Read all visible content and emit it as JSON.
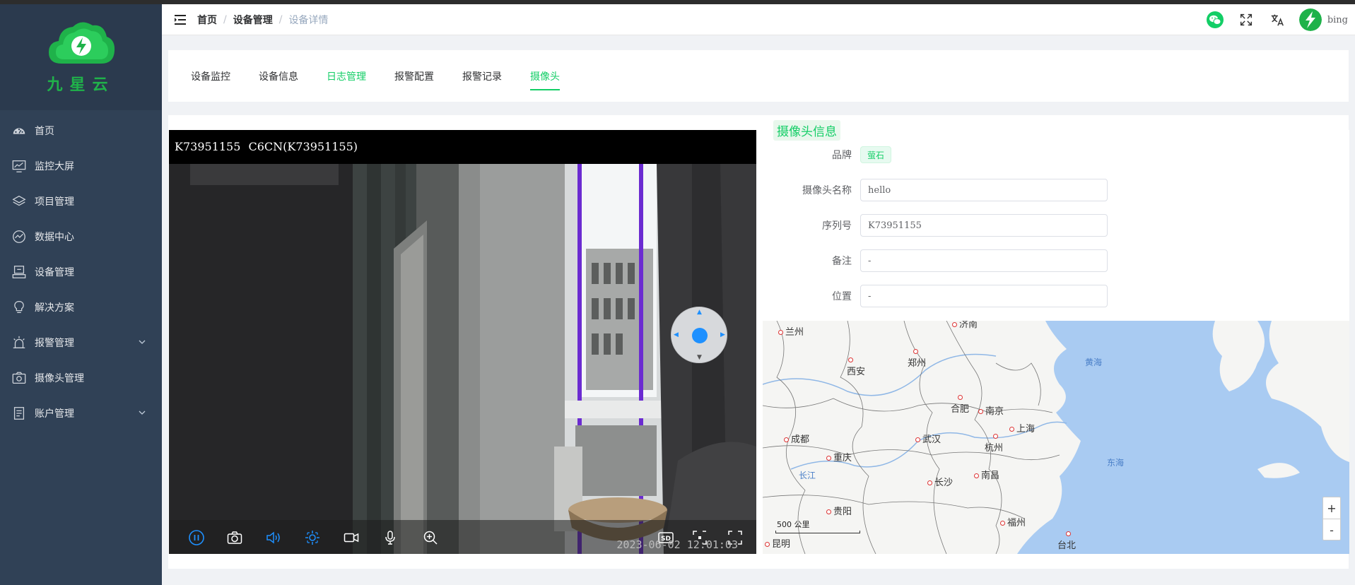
{
  "sidebar": {
    "logo_text": "九星云",
    "items": [
      {
        "label": "首页",
        "icon": "dashboard-icon"
      },
      {
        "label": "监控大屏",
        "icon": "monitor-icon"
      },
      {
        "label": "项目管理",
        "icon": "layers-icon"
      },
      {
        "label": "数据中心",
        "icon": "chart-icon"
      },
      {
        "label": "设备管理",
        "icon": "device-icon"
      },
      {
        "label": "解决方案",
        "icon": "bulb-icon"
      },
      {
        "label": "报警管理",
        "icon": "alarm-icon"
      },
      {
        "label": "摄像头管理",
        "icon": "camera-icon"
      },
      {
        "label": "账户管理",
        "icon": "account-icon"
      }
    ]
  },
  "header": {
    "breadcrumb": [
      "首页",
      "设备管理",
      "设备详情"
    ],
    "username": "bing"
  },
  "tabs": [
    {
      "label": "设备监控"
    },
    {
      "label": "设备信息"
    },
    {
      "label": "日志管理"
    },
    {
      "label": "报警配置"
    },
    {
      "label": "报警记录"
    },
    {
      "label": "摄像头"
    }
  ],
  "video": {
    "title": "K73951155   C6CN(K73951155)",
    "timestamp": "2023-06-02 12:01:03",
    "quality": "SD"
  },
  "info": {
    "title": "摄像头信息",
    "brand_label": "品牌",
    "brand_value": "萤石",
    "name_label": "摄像头名称",
    "name_value": "hello",
    "serial_label": "序列号",
    "serial_value": "K73951155",
    "remark_label": "备注",
    "remark_value": "-",
    "location_label": "位置",
    "location_value": "-"
  },
  "map": {
    "cities": [
      "兰州",
      "济南",
      "西安",
      "郑州",
      "南京",
      "合肥",
      "上海",
      "成都",
      "武汉",
      "重庆",
      "杭州",
      "南昌",
      "长沙",
      "贵阳",
      "福州",
      "昆明",
      "台北"
    ],
    "seas": [
      "黄海",
      "东海",
      "长江"
    ],
    "scale": "500 公里",
    "zoom_in": "+",
    "zoom_out": "-"
  },
  "colors": {
    "sidebar": "#304156",
    "accent": "#13ce66"
  }
}
